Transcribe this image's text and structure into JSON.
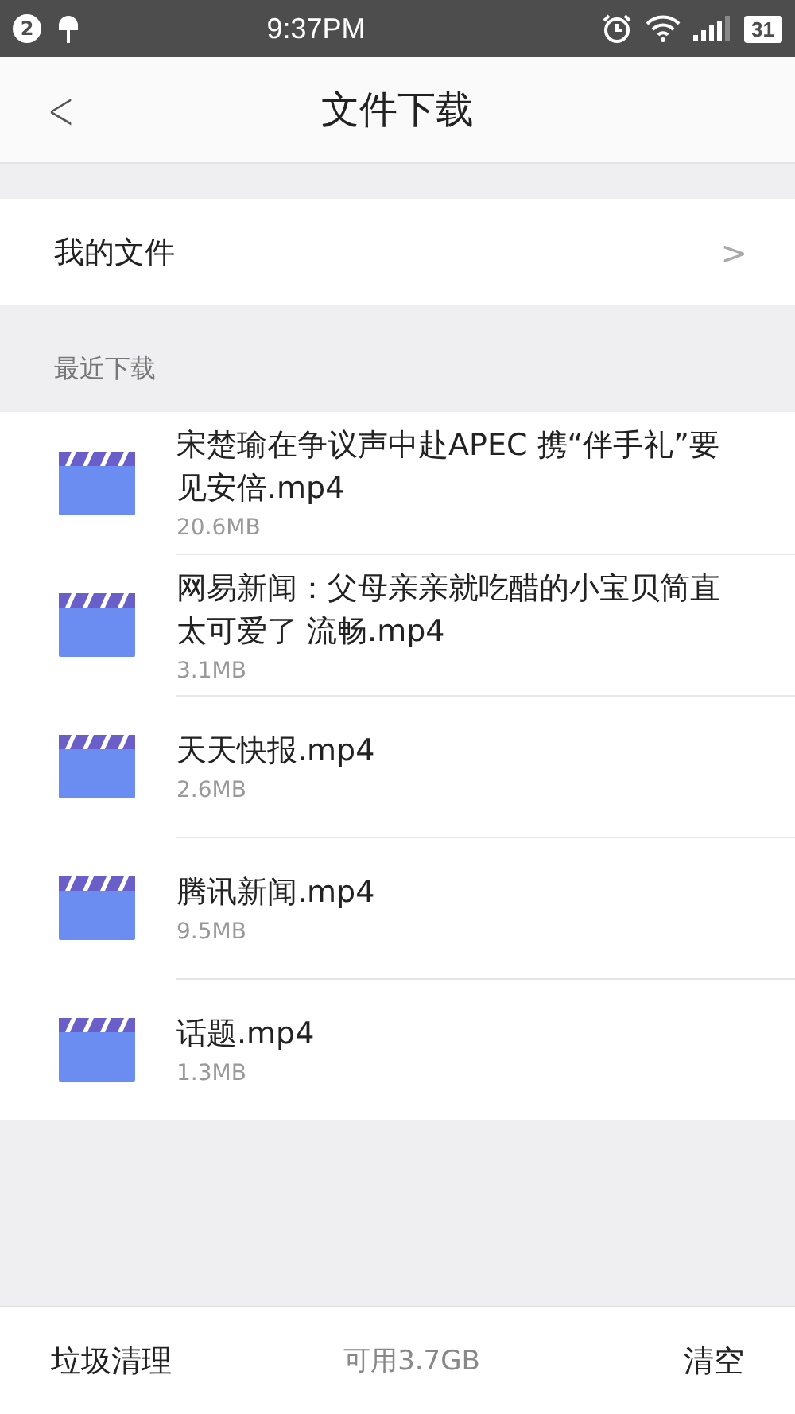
{
  "status_bar": {
    "notification_count": "2",
    "time": "9:37PM",
    "battery": "31"
  },
  "header": {
    "back": "<",
    "title": "文件下载"
  },
  "my_files": {
    "label": "我的文件",
    "chevron": ">"
  },
  "section": {
    "title": "最近下载"
  },
  "files": [
    {
      "name": "宋楚瑜在争议声中赴APEC 携“伴手礼”要见安倍.mp4",
      "size": "20.6MB"
    },
    {
      "name": "网易新闻：父母亲亲就吃醋的小宝贝简直太可爱了 流畅.mp4",
      "size": "3.1MB"
    },
    {
      "name": "天天快报.mp4",
      "size": "2.6MB"
    },
    {
      "name": "腾讯新闻.mp4",
      "size": "9.5MB"
    },
    {
      "name": "话题.mp4",
      "size": "1.3MB"
    }
  ],
  "bottom_bar": {
    "cleanup": "垃圾清理",
    "available": "可用3.7GB",
    "clear": "清空"
  }
}
